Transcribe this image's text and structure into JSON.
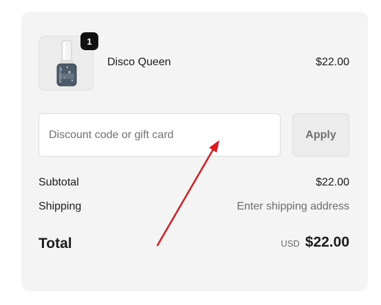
{
  "cart": {
    "items": [
      {
        "name": "Disco Queen",
        "price": "$22.00",
        "quantity": "1",
        "thumbnail_icon": "nail-polish-bottle-icon"
      }
    ]
  },
  "discount": {
    "placeholder": "Discount code or gift card",
    "value": "",
    "apply_label": "Apply"
  },
  "summary": {
    "subtotal_label": "Subtotal",
    "subtotal_value": "$22.00",
    "shipping_label": "Shipping",
    "shipping_value": "Enter shipping address",
    "total_label": "Total",
    "total_currency": "USD",
    "total_value": "$22.00"
  },
  "annotation": {
    "arrow_color": "#e0161c"
  },
  "colors": {
    "panel_bg": "#f4f4f4",
    "badge_bg": "#111111"
  }
}
